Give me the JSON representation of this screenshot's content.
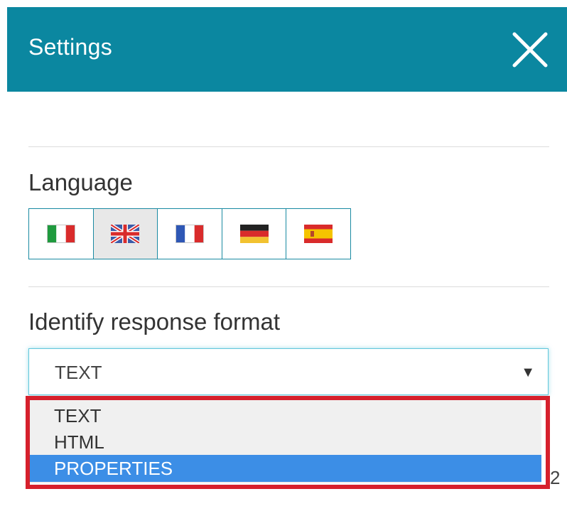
{
  "header": {
    "title": "Settings",
    "background": "#0b87a0",
    "close_icon": "close-icon"
  },
  "language": {
    "label": "Language",
    "options": [
      {
        "name": "Italian",
        "icon": "italy-flag-icon",
        "selected": false
      },
      {
        "name": "English",
        "icon": "uk-flag-icon",
        "selected": true
      },
      {
        "name": "French",
        "icon": "france-flag-icon",
        "selected": false
      },
      {
        "name": "German",
        "icon": "germany-flag-icon",
        "selected": false
      },
      {
        "name": "Spanish",
        "icon": "spain-flag-icon",
        "selected": false
      }
    ]
  },
  "response_format": {
    "label": "Identify response format",
    "selected_value": "TEXT",
    "arrow": "▼",
    "options": [
      {
        "label": "TEXT",
        "highlighted": false
      },
      {
        "label": "HTML",
        "highlighted": false
      },
      {
        "label": "PROPERTIES",
        "highlighted": true
      }
    ]
  },
  "annotation": {
    "highlight_color": "#d6202c"
  },
  "partial_text": "2",
  "colors": {
    "accent": "#0b87a0",
    "selected_option": "#3c8ee6",
    "focus_border": "#61c7db"
  }
}
